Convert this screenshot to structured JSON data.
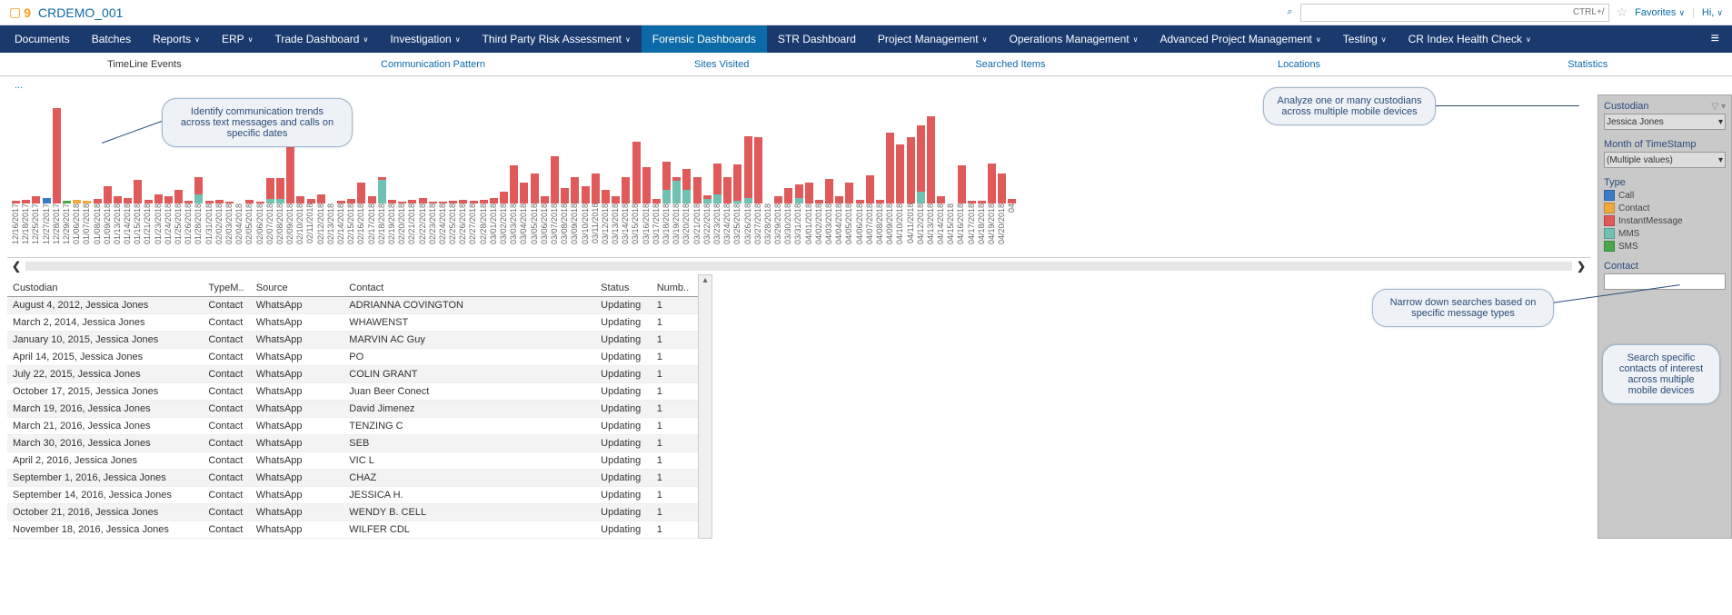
{
  "header": {
    "app_title": "CRDEMO_001",
    "search_placeholder": "CTRL+/",
    "favorites_label": "Favorites",
    "user_label": "Hi,"
  },
  "nav": {
    "items": [
      {
        "label": "Documents",
        "dd": false
      },
      {
        "label": "Batches",
        "dd": false
      },
      {
        "label": "Reports",
        "dd": true
      },
      {
        "label": "ERP",
        "dd": true
      },
      {
        "label": "Trade Dashboard",
        "dd": true
      },
      {
        "label": "Investigation",
        "dd": true
      },
      {
        "label": "Third Party Risk Assessment",
        "dd": true
      },
      {
        "label": "Forensic Dashboards",
        "dd": false,
        "active": true
      },
      {
        "label": "STR Dashboard",
        "dd": false
      },
      {
        "label": "Project Management",
        "dd": true
      },
      {
        "label": "Operations Management",
        "dd": true
      },
      {
        "label": "Advanced Project Management",
        "dd": true
      },
      {
        "label": "Testing",
        "dd": true
      },
      {
        "label": "CR Index Health Check",
        "dd": true
      }
    ]
  },
  "subnav": {
    "tabs": [
      {
        "label": "TimeLine Events",
        "active": true
      },
      {
        "label": "Communication Pattern"
      },
      {
        "label": "Sites Visited"
      },
      {
        "label": "Searched Items"
      },
      {
        "label": "Locations"
      },
      {
        "label": "Statistics"
      }
    ]
  },
  "breadcrumb": "...",
  "side": {
    "custodian_label": "Custodian",
    "custodian_value": "Jessica Jones",
    "month_label": "Month of TimeStamp",
    "month_value": "(Multiple values)",
    "type_label": "Type",
    "contact_label": "Contact",
    "legend": [
      {
        "name": "Call",
        "color": "#3a7cc4"
      },
      {
        "name": "Contact",
        "color": "#f2a93b"
      },
      {
        "name": "InstantMessage",
        "color": "#e15a5a"
      },
      {
        "name": "MMS",
        "color": "#6fc1b1"
      },
      {
        "name": "SMS",
        "color": "#4aa84a"
      }
    ]
  },
  "callouts": {
    "c1": "Identify communication trends across text messages and calls on specific dates",
    "c2": "Analyze one or many custodians across multiple mobile devices",
    "c3": "Narrow down searches based on specific message types",
    "c4": "Search specific contacts of interest across multiple mobile devices"
  },
  "chart_data": {
    "type": "bar",
    "title": "",
    "xlabel": "",
    "ylabel": "",
    "ylim": [
      0,
      110
    ],
    "categories": [
      "12/16/2017",
      "12/18/2017",
      "12/25/2017",
      "12/27/2017",
      "12/28/2017",
      "12/29/2017",
      "01/06/2018",
      "01/07/2018",
      "01/08/2018",
      "01/09/2018",
      "01/13/2018",
      "01/14/2018",
      "01/15/2018",
      "01/21/2018",
      "01/23/2018",
      "01/24/2018",
      "01/25/2018",
      "01/26/2018",
      "01/28/2018",
      "01/31/2018",
      "02/02/2018",
      "02/03/2018",
      "02/04/2018",
      "02/05/2018",
      "02/06/2018",
      "02/07/2018",
      "02/08/2018",
      "02/09/2018",
      "02/10/2018",
      "02/11/2018",
      "02/12/2018",
      "02/13/2018",
      "02/14/2018",
      "02/15/2018",
      "02/16/2018",
      "02/17/2018",
      "02/18/2018",
      "02/19/2018",
      "02/20/2018",
      "02/21/2018",
      "02/22/2018",
      "02/23/2018",
      "02/24/2018",
      "02/25/2018",
      "02/26/2018",
      "02/27/2018",
      "02/28/2018",
      "03/01/2018",
      "03/02/2018",
      "03/03/2018",
      "03/04/2018",
      "03/05/2018",
      "03/06/2018",
      "03/07/2018",
      "03/08/2018",
      "03/09/2018",
      "03/10/2018",
      "03/11/2018",
      "03/12/2018",
      "03/13/2018",
      "03/14/2018",
      "03/15/2018",
      "03/16/2018",
      "03/17/2018",
      "03/18/2018",
      "03/19/2018",
      "03/20/2018",
      "03/21/2018",
      "03/22/2018",
      "03/23/2018",
      "03/24/2018",
      "03/25/2018",
      "03/26/2018",
      "03/27/2018",
      "03/28/2018",
      "03/29/2018",
      "03/30/2018",
      "03/31/2018",
      "04/01/2018",
      "04/02/2018",
      "04/03/2018",
      "04/04/2018",
      "04/05/2018",
      "04/06/2018",
      "04/07/2018",
      "04/08/2018",
      "04/09/2018",
      "04/10/2018",
      "04/11/2018",
      "04/12/2018",
      "04/13/2018",
      "04/14/2018",
      "04/15/2018",
      "04/16/2018",
      "04/17/2018",
      "04/18/2018",
      "04/19/2018",
      "04/20/2018",
      "04"
    ],
    "series": [
      {
        "name": "Call",
        "color": "#3a7cc4",
        "values": [
          0,
          0,
          0,
          6,
          0,
          0,
          0,
          0,
          0,
          0,
          0,
          0,
          0,
          0,
          0,
          0,
          0,
          0,
          0,
          0,
          0,
          0,
          0,
          0,
          0,
          0,
          0,
          0,
          0,
          0,
          0,
          0,
          0,
          0,
          0,
          0,
          0,
          0,
          0,
          0,
          0,
          0,
          0,
          0,
          0,
          0,
          0,
          0,
          0,
          0,
          0,
          0,
          0,
          0,
          0,
          0,
          0,
          0,
          0,
          0,
          0,
          0,
          0,
          0,
          0,
          0,
          0,
          0,
          0,
          0,
          0,
          0,
          0,
          0,
          0,
          0,
          0,
          0,
          0,
          0,
          0,
          0,
          0,
          0,
          0,
          0,
          0,
          0,
          0,
          0,
          0,
          0,
          0,
          0,
          0,
          0,
          0,
          0,
          0
        ]
      },
      {
        "name": "Contact",
        "color": "#f2a93b",
        "values": [
          0,
          0,
          0,
          0,
          0,
          0,
          4,
          3,
          0,
          0,
          0,
          0,
          0,
          0,
          0,
          0,
          0,
          0,
          0,
          0,
          0,
          0,
          0,
          0,
          0,
          0,
          0,
          0,
          0,
          0,
          0,
          0,
          0,
          0,
          0,
          0,
          0,
          0,
          0,
          0,
          0,
          0,
          0,
          0,
          0,
          0,
          0,
          0,
          0,
          0,
          0,
          0,
          0,
          0,
          0,
          0,
          0,
          0,
          0,
          0,
          0,
          0,
          0,
          0,
          0,
          0,
          0,
          0,
          0,
          0,
          0,
          0,
          0,
          0,
          0,
          0,
          0,
          0,
          0,
          0,
          0,
          0,
          0,
          0,
          0,
          0,
          0,
          0,
          0,
          0,
          0,
          0,
          0,
          0,
          0,
          0,
          0,
          0,
          0
        ]
      },
      {
        "name": "InstantMessage",
        "color": "#e15a5a",
        "values": [
          3,
          4,
          8,
          0,
          100,
          0,
          0,
          0,
          5,
          18,
          8,
          6,
          25,
          4,
          10,
          8,
          14,
          3,
          18,
          3,
          4,
          2,
          0,
          4,
          2,
          22,
          22,
          60,
          8,
          5,
          10,
          0,
          3,
          5,
          22,
          8,
          3,
          4,
          2,
          4,
          6,
          2,
          2,
          3,
          4,
          3,
          4,
          6,
          12,
          40,
          22,
          32,
          8,
          50,
          16,
          28,
          18,
          32,
          14,
          8,
          28,
          65,
          38,
          5,
          30,
          4,
          22,
          28,
          4,
          32,
          28,
          38,
          65,
          70,
          0,
          8,
          16,
          14,
          22,
          4,
          26,
          8,
          22,
          4,
          30,
          4,
          75,
          62,
          70,
          70,
          92,
          8,
          0,
          40,
          3,
          3,
          42,
          32,
          5
        ]
      },
      {
        "name": "MMS",
        "color": "#6fc1b1",
        "values": [
          0,
          0,
          0,
          0,
          0,
          0,
          0,
          0,
          0,
          0,
          0,
          0,
          0,
          0,
          0,
          0,
          0,
          0,
          10,
          0,
          0,
          0,
          0,
          0,
          0,
          5,
          5,
          0,
          0,
          0,
          0,
          0,
          0,
          0,
          0,
          0,
          25,
          0,
          0,
          0,
          0,
          0,
          0,
          0,
          0,
          0,
          0,
          0,
          0,
          0,
          0,
          0,
          0,
          0,
          0,
          0,
          0,
          0,
          0,
          0,
          0,
          0,
          0,
          0,
          14,
          24,
          14,
          0,
          5,
          10,
          0,
          3,
          6,
          0,
          0,
          0,
          0,
          6,
          0,
          0,
          0,
          0,
          0,
          0,
          0,
          0,
          0,
          0,
          0,
          12,
          0,
          0,
          0,
          0,
          0,
          0,
          0,
          0,
          0
        ]
      },
      {
        "name": "SMS",
        "color": "#4aa84a",
        "values": [
          0,
          0,
          0,
          0,
          0,
          3,
          0,
          0,
          0,
          0,
          0,
          0,
          0,
          0,
          0,
          0,
          0,
          0,
          0,
          0,
          0,
          0,
          0,
          0,
          0,
          0,
          0,
          0,
          0,
          0,
          0,
          0,
          0,
          0,
          0,
          0,
          0,
          0,
          0,
          0,
          0,
          0,
          0,
          0,
          0,
          0,
          0,
          0,
          0,
          0,
          0,
          0,
          0,
          0,
          0,
          0,
          0,
          0,
          0,
          0,
          0,
          0,
          0,
          0,
          0,
          0,
          0,
          0,
          0,
          0,
          0,
          0,
          0,
          0,
          0,
          0,
          0,
          0,
          0,
          0,
          0,
          0,
          0,
          0,
          0,
          0,
          0,
          0,
          0,
          0,
          0,
          0,
          0,
          0,
          0,
          0,
          0,
          0,
          0
        ]
      }
    ]
  },
  "table": {
    "headers": [
      "Custodian",
      "TypeM..",
      "Source",
      "Contact",
      "Status",
      "Numb.."
    ],
    "rows": [
      {
        "c": "August 4, 2012, Jessica Jones",
        "t": "Contact",
        "s": "WhatsApp",
        "o": "ADRIANNA COVINGTON",
        "st": "Updating",
        "n": "1"
      },
      {
        "c": "March 2, 2014, Jessica Jones",
        "t": "Contact",
        "s": "WhatsApp",
        "o": "WHAWENST",
        "st": "Updating",
        "n": "1"
      },
      {
        "c": "January 10, 2015, Jessica Jones",
        "t": "Contact",
        "s": "WhatsApp",
        "o": "MARVIN AC Guy",
        "st": "Updating",
        "n": "1"
      },
      {
        "c": "April 14, 2015, Jessica Jones",
        "t": "Contact",
        "s": "WhatsApp",
        "o": "PO",
        "st": "Updating",
        "n": "1"
      },
      {
        "c": "July 22, 2015, Jessica Jones",
        "t": "Contact",
        "s": "WhatsApp",
        "o": "COLIN GRANT",
        "st": "Updating",
        "n": "1"
      },
      {
        "c": "October 17, 2015, Jessica Jones",
        "t": "Contact",
        "s": "WhatsApp",
        "o": "Juan Beer Conect",
        "st": "Updating",
        "n": "1"
      },
      {
        "c": "March 19, 2016, Jessica Jones",
        "t": "Contact",
        "s": "WhatsApp",
        "o": "David Jimenez",
        "st": "Updating",
        "n": "1"
      },
      {
        "c": "March 21, 2016, Jessica Jones",
        "t": "Contact",
        "s": "WhatsApp",
        "o": "TENZING C",
        "st": "Updating",
        "n": "1"
      },
      {
        "c": "March 30, 2016, Jessica Jones",
        "t": "Contact",
        "s": "WhatsApp",
        "o": "SEB",
        "st": "Updating",
        "n": "1"
      },
      {
        "c": "April 2, 2016, Jessica Jones",
        "t": "Contact",
        "s": "WhatsApp",
        "o": "VIC L",
        "st": "Updating",
        "n": "1"
      },
      {
        "c": "September 1, 2016, Jessica Jones",
        "t": "Contact",
        "s": "WhatsApp",
        "o": "CHAZ",
        "st": "Updating",
        "n": "1"
      },
      {
        "c": "September 14, 2016, Jessica Jones",
        "t": "Contact",
        "s": "WhatsApp",
        "o": "JESSICA H.",
        "st": "Updating",
        "n": "1"
      },
      {
        "c": "October 21, 2016, Jessica Jones",
        "t": "Contact",
        "s": "WhatsApp",
        "o": "WENDY B. CELL",
        "st": "Updating",
        "n": "1"
      },
      {
        "c": "November 18, 2016, Jessica Jones",
        "t": "Contact",
        "s": "WhatsApp",
        "o": "WILFER CDL",
        "st": "Updating",
        "n": "1"
      }
    ]
  }
}
